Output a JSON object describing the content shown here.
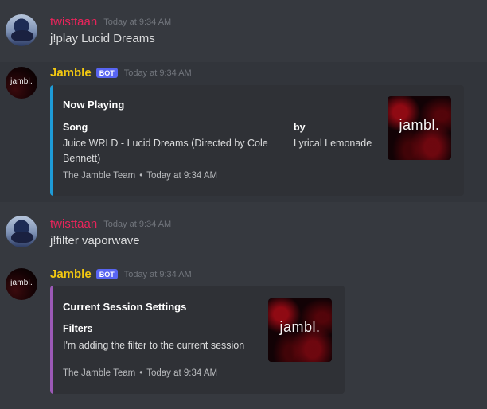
{
  "messages": [
    {
      "author": "twisttaan",
      "timestamp": "Today at 9:34 AM",
      "content": "j!play Lucid Dreams"
    },
    {
      "author": "Jamble",
      "badge": "BOT",
      "timestamp": "Today at 9:34 AM",
      "avatar_text": "jambl.",
      "embed": {
        "title": "Now Playing",
        "fields": [
          {
            "name": "Song",
            "value": "Juice WRLD - Lucid Dreams (Directed by Cole Bennett)"
          },
          {
            "name": "by",
            "value": "Lyrical Lemonade"
          }
        ],
        "thumbnail_text": "jambl.",
        "footer": {
          "text": "The Jamble Team",
          "separator": "•",
          "timestamp": "Today at 9:34 AM"
        },
        "color": "#1e9bd7"
      }
    },
    {
      "author": "twisttaan",
      "timestamp": "Today at 9:34 AM",
      "content": "j!filter vaporwave"
    },
    {
      "author": "Jamble",
      "badge": "BOT",
      "timestamp": "Today at 9:34 AM",
      "avatar_text": "jambl.",
      "embed": {
        "title": "Current Session Settings",
        "fields": [
          {
            "name": "Filters",
            "value": "I'm adding the filter to the current session"
          }
        ],
        "thumbnail_text": "jambl.",
        "footer": {
          "text": "The Jamble Team",
          "separator": "•",
          "timestamp": "Today at 9:34 AM"
        },
        "color": "#9b59b6"
      }
    }
  ],
  "colors": {
    "background": "#36393f",
    "embed_background": "#2f3136",
    "user_name": "#e9245b",
    "bot_name": "#f2c811",
    "bot_badge": "#5865f2"
  }
}
